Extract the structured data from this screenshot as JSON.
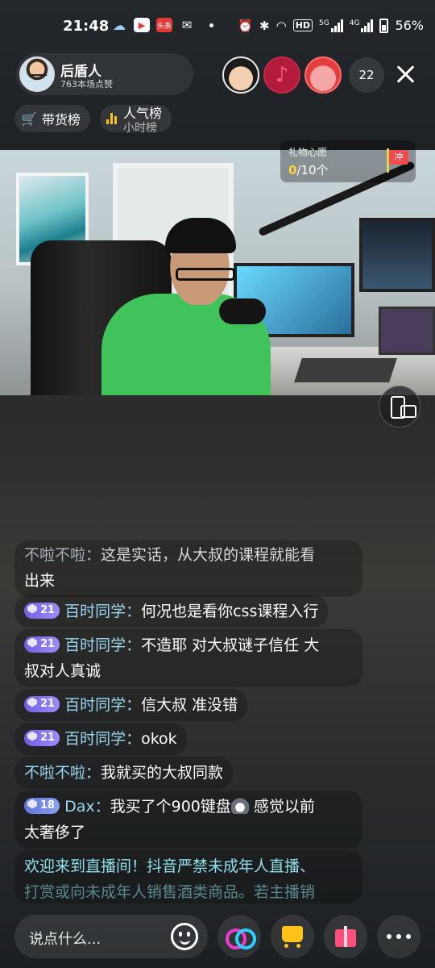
{
  "status_bar": {
    "time": "21:48",
    "battery": "56%",
    "app_icons": [
      "weather-icon",
      "video-app-icon",
      "toutiao-icon",
      "wechat-icon"
    ],
    "toutiao_label": "头条",
    "hd_label": "HD",
    "net1": "5G",
    "net2": "4G"
  },
  "host": {
    "name": "后盾人",
    "likes": "763本场点赞"
  },
  "viewers": {
    "count": "22"
  },
  "chips": {
    "sales_rank": "带货榜",
    "popularity_rank": "人气榜",
    "popularity_sub": "小时榜"
  },
  "gift_wish": {
    "title": "礼物心愿",
    "current": "0",
    "total": "/10个",
    "flag_label": "冲"
  },
  "comments": [
    {
      "nick": "不啦不啦：",
      "text": "这是实话，从大叔的课程就能看",
      "text2": "出来",
      "level": ""
    },
    {
      "nick": "百时同学：",
      "text": "何况也是看你css课程入行",
      "level": "21"
    },
    {
      "nick": "百时同学：",
      "text": "不造耶  对大叔谜子信任 大",
      "text2": "叔对人真诚",
      "level": "21"
    },
    {
      "nick": "百时同学：",
      "text": "信大叔 准没错",
      "level": "21"
    },
    {
      "nick": "百时同学：",
      "text": "okok",
      "level": "21"
    },
    {
      "nick": "不啦不啦：",
      "text": "我就买的大叔同款",
      "level": ""
    },
    {
      "nick": "Dax：",
      "text": "我买了个900键盘",
      "text_after_emoji": " 感觉以前",
      "text2": "太奢侈了",
      "level": "18"
    }
  ],
  "welcome": {
    "line1": "欢迎来到直播间！抖音严禁未成年人直播、",
    "line2": "打赏或向未成年人销售酒类商品。若主播销"
  },
  "bottom": {
    "input_placeholder": "说点什么..."
  },
  "colors": {
    "accent_yellow": "#ffc21a",
    "nick_blue": "#9bd8f2",
    "welcome_cyan": "#8fe0e8",
    "badge_purple": "#7b6be6"
  }
}
